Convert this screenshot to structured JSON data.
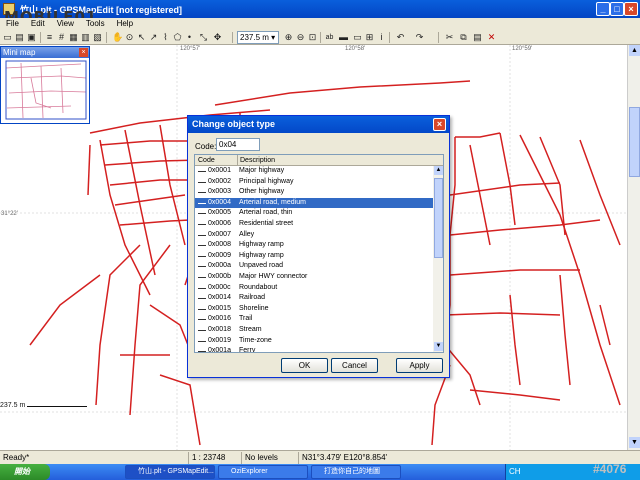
{
  "window": {
    "title": "竹山.plt - GPSMapEdit [not registered]"
  },
  "menu": [
    "File",
    "Edit",
    "View",
    "Tools",
    "Help"
  ],
  "toolbar": {
    "zoom": "237.5 m",
    "zoom_arrow": "▾"
  },
  "map": {
    "coords": [
      "120°57'",
      "120°58'",
      "120°59'",
      "31°22'"
    ]
  },
  "minimap": {
    "title": "Mini map",
    "close": "×"
  },
  "dialog": {
    "title": "Change object type",
    "close": "×",
    "code_label": "Code:",
    "code_value": "0x04",
    "columns": [
      "Code",
      "Description"
    ],
    "rows": [
      {
        "code": "0x0001",
        "desc": "Major highway"
      },
      {
        "code": "0x0002",
        "desc": "Principal highway"
      },
      {
        "code": "0x0003",
        "desc": "Other highway"
      },
      {
        "code": "0x0004",
        "desc": "Arterial road, medium"
      },
      {
        "code": "0x0005",
        "desc": "Arterial road, thin"
      },
      {
        "code": "0x0006",
        "desc": "Residential street"
      },
      {
        "code": "0x0007",
        "desc": "Alley"
      },
      {
        "code": "0x0008",
        "desc": "Highway ramp"
      },
      {
        "code": "0x0009",
        "desc": "Highway ramp"
      },
      {
        "code": "0x000a",
        "desc": "Unpaved road"
      },
      {
        "code": "0x000b",
        "desc": "Major HWY connector"
      },
      {
        "code": "0x000c",
        "desc": "Roundabout"
      },
      {
        "code": "0x0014",
        "desc": "Railroad"
      },
      {
        "code": "0x0015",
        "desc": "Shoreline"
      },
      {
        "code": "0x0016",
        "desc": "Trail"
      },
      {
        "code": "0x0018",
        "desc": "Stream"
      },
      {
        "code": "0x0019",
        "desc": "Time-zone"
      },
      {
        "code": "0x001a",
        "desc": "Ferry"
      }
    ],
    "selected_index": 3,
    "ok": "OK",
    "cancel": "Cancel",
    "apply": "Apply"
  },
  "scale": "237.5 m",
  "status": {
    "ready": "Ready*",
    "ratio": "1 : 23748",
    "levels": "No levels",
    "position": "N31°3.479' E120°8.854'"
  },
  "taskbar": {
    "start": "開始",
    "tasks": [
      "竹山.plt - GPSMapEdit...",
      "OziExplorer",
      "打造你自己的地圖"
    ],
    "tray": "CH"
  },
  "watermark": "MOBILE01",
  "watermark2": "#4076",
  "colors": {
    "road": "#d42020",
    "selection": "#316ac5",
    "titlebar": "#0a5fdc"
  }
}
